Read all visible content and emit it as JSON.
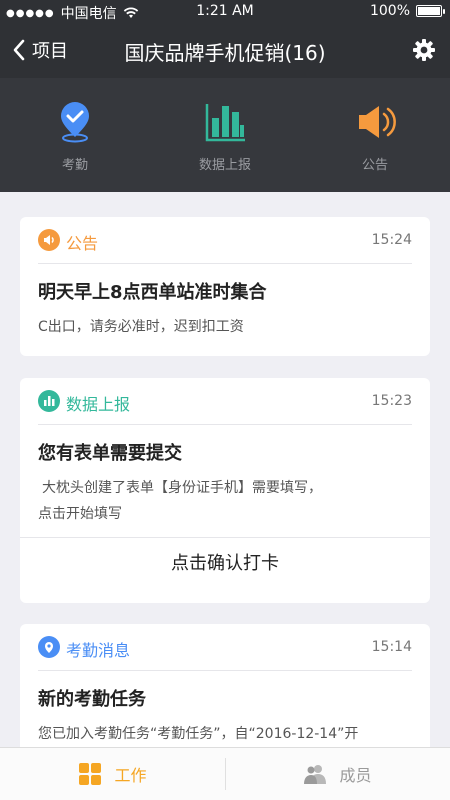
{
  "status": {
    "carrier": "中国电信",
    "time": "1:21 AM",
    "battery": "100%",
    "battery_level": 1
  },
  "nav": {
    "back_label": "项目",
    "title": "国庆品牌手机促销(16)"
  },
  "tools": [
    {
      "label": "考勤",
      "icon": "checkin-location-icon",
      "color": "#4a8ef5"
    },
    {
      "label": "数据上报",
      "icon": "bar-chart-icon",
      "color": "#33b89b"
    },
    {
      "label": "公告",
      "icon": "speaker-icon",
      "color": "#f59a3e"
    }
  ],
  "cards": [
    {
      "type": "公告",
      "time": "15:24",
      "title": "明天早上8点西单站准时集合",
      "desc": "C出口，请务必准时，迟到扣工资",
      "badge_color": "#f59a3e",
      "label_color": "#f59a3e"
    },
    {
      "type": "数据上报",
      "time": "15:23",
      "title": "您有表单需要提交",
      "desc_line1": "大枕头创建了表单【身份证手机】需要填写，",
      "desc_line2": "点击开始填写",
      "action": "点击确认打卡",
      "badge_color": "#33b89b",
      "label_color": "#33b89b"
    },
    {
      "type": "考勤消息",
      "time": "15:14",
      "title": "新的考勤任务",
      "desc": "您已加入考勤任务“考勤任务”，自“2016-12-14”开",
      "badge_color": "#4a8ef5",
      "label_color": "#4a8ef5"
    }
  ],
  "tabs": [
    {
      "label": "工作",
      "active": true,
      "color": "#f5a623"
    },
    {
      "label": "成员",
      "active": false,
      "color": "#9a9a9a"
    }
  ]
}
